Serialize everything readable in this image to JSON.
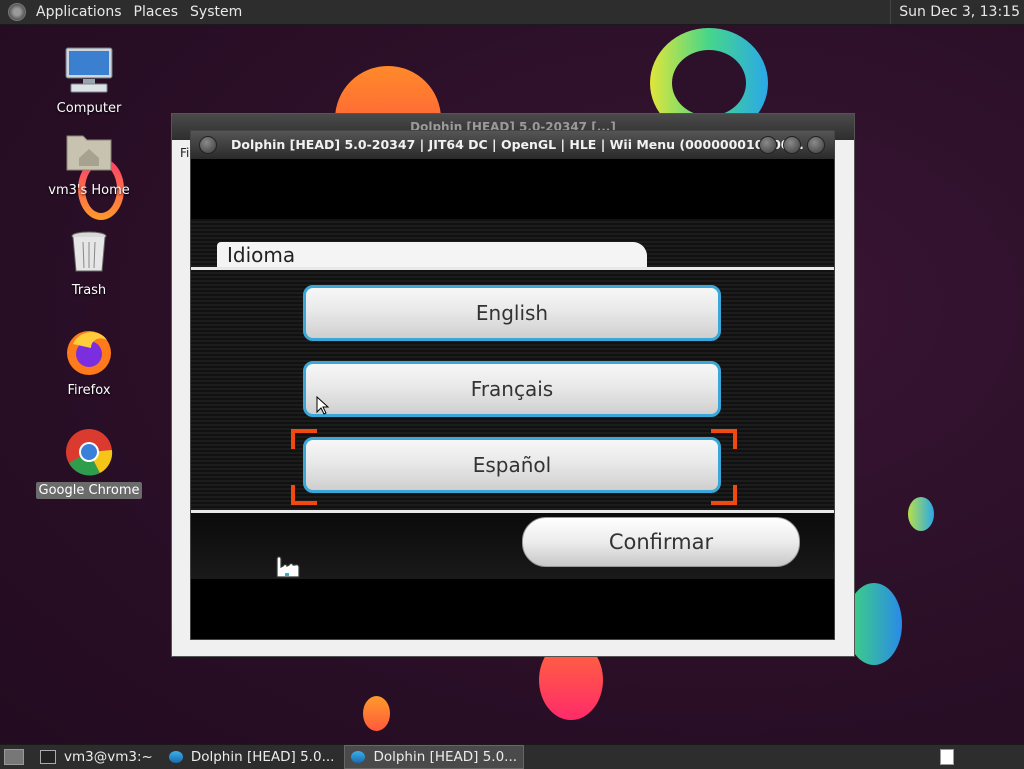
{
  "top_panel": {
    "menus": [
      "Applications",
      "Places",
      "System"
    ],
    "clock": "Sun Dec  3, 13:15"
  },
  "desktop_icons": [
    {
      "label": "Computer",
      "icon": "computer-icon"
    },
    {
      "label": "vm3's Home",
      "icon": "home-folder-icon"
    },
    {
      "label": "Trash",
      "icon": "trash-icon"
    },
    {
      "label": "Firefox",
      "icon": "firefox-icon"
    },
    {
      "label": "Google Chrome",
      "icon": "chrome-icon"
    }
  ],
  "bg_window": {
    "title": "Dolphin [HEAD] 5.0-20347 [...]",
    "menu_initial": "Fi"
  },
  "window": {
    "title": "Dolphin [HEAD] 5.0-20347 | JIT64 DC | OpenGL | HLE | Wii Menu (000000010000..."
  },
  "wii_screen": {
    "tab_title": "Idioma",
    "options": [
      "English",
      "Français",
      "Español"
    ],
    "selected": "Español",
    "confirm": "Confirmar"
  },
  "taskbar": {
    "tasks": [
      {
        "label": "vm3@vm3:~",
        "icon": "terminal-icon",
        "active": false
      },
      {
        "label": "Dolphin [HEAD] 5.0...",
        "icon": "dolphin-icon",
        "active": false
      },
      {
        "label": "Dolphin [HEAD] 5.0...",
        "icon": "dolphin-icon",
        "active": true
      }
    ]
  },
  "colors": {
    "accent_blue": "#3aa7d8",
    "selection_orange": "#f04a10",
    "panel": "#2d2d2d"
  }
}
